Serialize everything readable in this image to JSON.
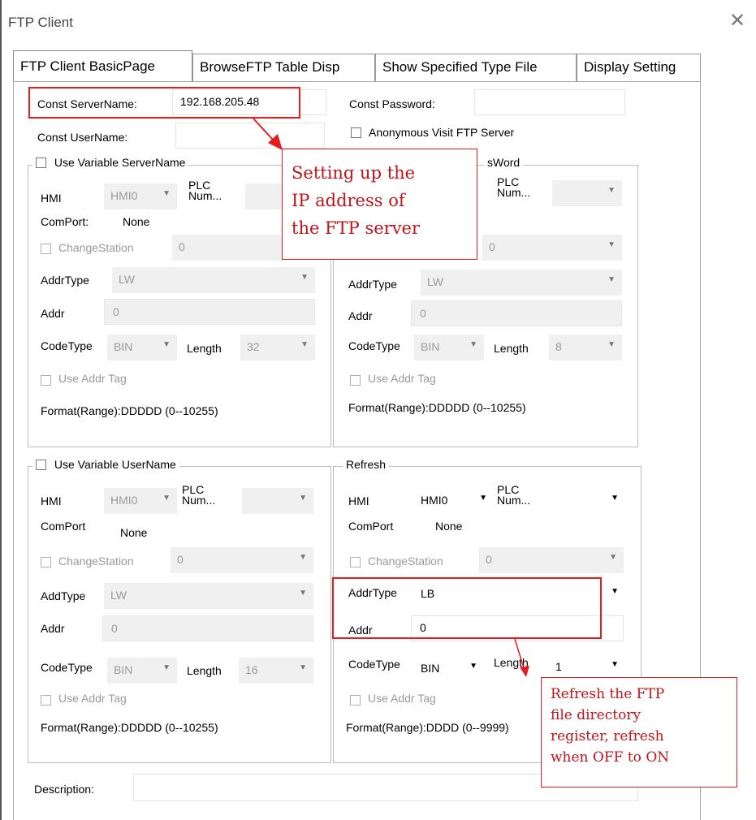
{
  "window": {
    "title": "FTP Client"
  },
  "tabs": [
    {
      "label": "FTP Client BasicPage",
      "active": true
    },
    {
      "label": "BrowseFTP Table Disp"
    },
    {
      "label": "Show Specified Type File"
    },
    {
      "label": "Display Setting"
    }
  ],
  "const": {
    "server_label": "Const ServerName:",
    "server_value": "192.168.205.48",
    "password_label": "Const Password:",
    "password_value": "",
    "user_label": "Const UserName:",
    "user_value": "",
    "anonymous_label": "Anonymous Visit FTP Server"
  },
  "group_server": {
    "title": "Use Variable ServerName",
    "hmi_label": "HMI",
    "hmi_value": "HMI0",
    "plc_label_1": "PLC",
    "plc_label_2": "Num...",
    "comport_label": "ComPort:",
    "comport_value": "None",
    "change_station_label": "ChangeStation",
    "change_station_value": "0",
    "addrtype_label": "AddrType",
    "addrtype_value": "LW",
    "addr_label": "Addr",
    "addr_value": "0",
    "codetype_label": "CodeType",
    "codetype_value": "BIN",
    "length_label": "Length",
    "length_value": "32",
    "use_addr_tag_label": "Use Addr Tag",
    "format_label": "Format(Range):DDDDD (0--10255)"
  },
  "group_password": {
    "title_visible": "sWord",
    "plc_label_1": "PLC",
    "plc_label_2": "Num...",
    "change_station_value": "0",
    "addrtype_label": "AddrType",
    "addrtype_value": "LW",
    "addr_label": "Addr",
    "addr_value": "0",
    "codetype_label": "CodeType",
    "codetype_value": "BIN",
    "length_label": "Length",
    "length_value": "8",
    "use_addr_tag_label": "Use Addr Tag",
    "format_label": "Format(Range):DDDDD (0--10255)"
  },
  "group_user": {
    "title": "Use Variable UserName",
    "hmi_label": "HMI",
    "hmi_value": "HMI0",
    "plc_label_1": "PLC",
    "plc_label_2": "Num...",
    "comport_label": "ComPort",
    "comport_value": "None",
    "change_station_label": "ChangeStation",
    "change_station_value": "0",
    "addrtype_label": "AddType",
    "addrtype_value": "LW",
    "addr_label": "Addr",
    "addr_value": "0",
    "codetype_label": "CodeType",
    "codetype_value": "BIN",
    "length_label": "Length",
    "length_value": "16",
    "use_addr_tag_label": "Use Addr Tag",
    "format_label": "Format(Range):DDDDD (0--10255)"
  },
  "group_refresh": {
    "title": "Refresh",
    "hmi_label": "HMI",
    "hmi_value": "HMI0",
    "plc_label_1": "PLC",
    "plc_label_2": "Num...",
    "comport_label": "ComPort",
    "comport_value": "None",
    "change_station_label": "ChangeStation",
    "change_station_value": "0",
    "addrtype_label": "AddrType",
    "addrtype_value": "LB",
    "addr_label": "Addr",
    "addr_value": "0",
    "codetype_label": "CodeType",
    "codetype_value": "BIN",
    "length_label": "Length",
    "length_value": "1",
    "use_addr_tag_label": "Use Addr Tag",
    "format_label": "Format(Range):DDDD (0--9999)"
  },
  "description": {
    "label": "Description:",
    "value": ""
  },
  "annotations": {
    "server_callout": "Setting up the\nIP address of\nthe FTP server",
    "refresh_callout": "Refresh the FTP\nfile directory\nregister, refresh\nwhen OFF to ON"
  },
  "colors": {
    "annotation_red": "#e41d1d",
    "callout_text": "#c0141b",
    "disabled_text": "#9a9a9a"
  }
}
